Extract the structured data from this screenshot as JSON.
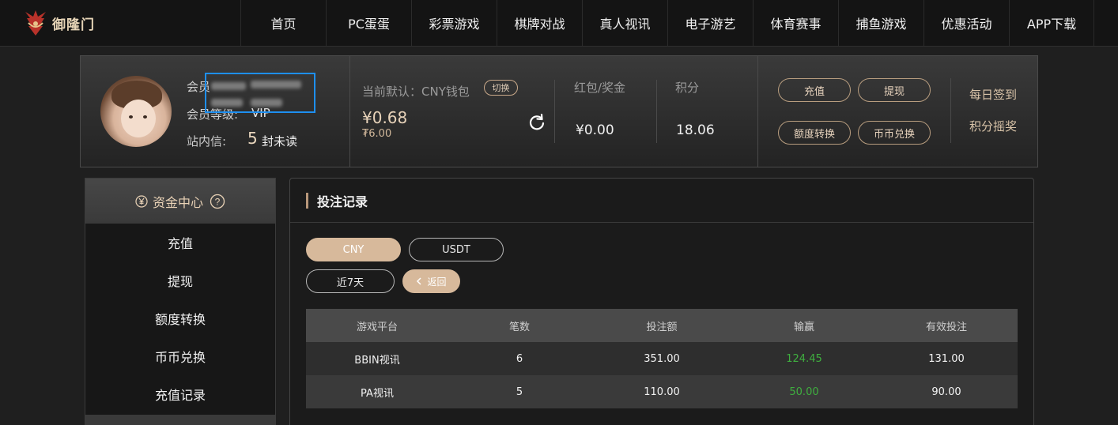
{
  "brand": {
    "logo_text": "御隆门"
  },
  "nav": {
    "items": [
      {
        "label": "首页"
      },
      {
        "label": "PC蛋蛋"
      },
      {
        "label": "彩票游戏"
      },
      {
        "label": "棋牌对战"
      },
      {
        "label": "真人视讯"
      },
      {
        "label": "电子游艺"
      },
      {
        "label": "体育赛事"
      },
      {
        "label": "捕鱼游戏"
      },
      {
        "label": "优惠活动"
      },
      {
        "label": "APP下载"
      }
    ]
  },
  "profile": {
    "member_label": "会员",
    "level_label": "会员等级:",
    "level_value": "VIP",
    "mail_label": "站内信:",
    "mail_count": "5",
    "mail_suffix": "封未读",
    "wallet_label": "当前默认：CNY钱包",
    "switch_label": "切换",
    "balance": "¥0.68",
    "balance_sub": "₮6.00",
    "bonus_label": "红包/奖金",
    "bonus_value": "¥0.00",
    "points_label": "积分",
    "points_value": "18.06",
    "buttons": {
      "deposit": "充值",
      "withdraw": "提现",
      "transfer": "额度转换",
      "exchange": "币币兑换"
    },
    "daily_checkin": "每日签到",
    "points_lottery": "积分摇奖"
  },
  "sidebar": {
    "title": "资金中心",
    "items": [
      {
        "label": "充值"
      },
      {
        "label": "提现"
      },
      {
        "label": "额度转换"
      },
      {
        "label": "币币兑换"
      },
      {
        "label": "充值记录"
      }
    ]
  },
  "main": {
    "title": "投注记录",
    "currency_tabs": [
      {
        "label": "CNY",
        "active": true
      },
      {
        "label": "USDT",
        "active": false
      }
    ],
    "range_label": "近7天",
    "back_label": "返回",
    "table": {
      "headers": [
        "游戏平台",
        "笔数",
        "投注额",
        "输赢",
        "有效投注"
      ],
      "rows": [
        {
          "platform": "BBIN视讯",
          "count": "6",
          "amount": "351.00",
          "winloss": "124.45",
          "valid": "131.00"
        },
        {
          "platform": "PA视讯",
          "count": "5",
          "amount": "110.00",
          "winloss": "50.00",
          "valid": "90.00"
        }
      ]
    }
  },
  "colors": {
    "accent_gold": "#d7b99b",
    "win_green": "#3fae3f",
    "highlight_blue": "#1e8ff0"
  }
}
